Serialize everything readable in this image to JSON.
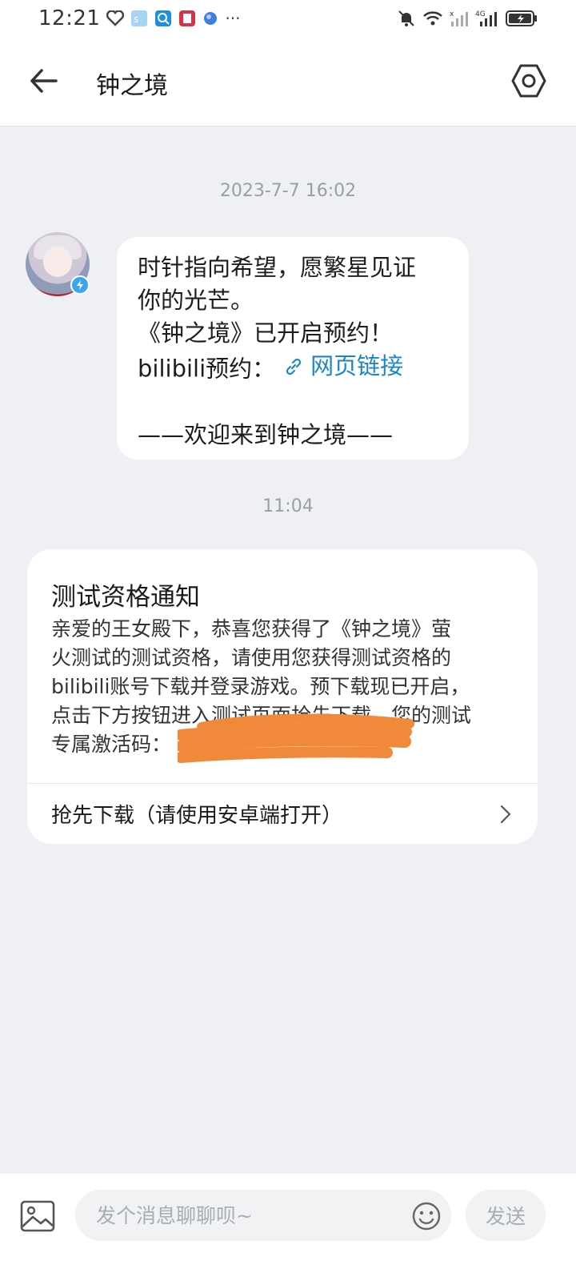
{
  "status_bar": {
    "time": "12:21",
    "icons": [
      "heart-pulse-icon",
      "app-icon",
      "search-app-icon",
      "book-app-icon",
      "globe-app-icon",
      "more-notifications-icon",
      "mute-bell-icon",
      "wifi-icon",
      "signal-icon",
      "4g-signal-icon",
      "battery-charging-icon"
    ],
    "more": "···"
  },
  "header": {
    "title": "钟之境",
    "back_icon": "arrow-left-icon",
    "settings_icon": "hexagon-settings-icon"
  },
  "conversation": {
    "timestamp_1": "2023-7-7 16:02",
    "message_1": {
      "line_1": "时针指向希望，愿繁星见证",
      "line_2": "你的光芒。",
      "line_3": "《钟之境》已开启预约！",
      "line_4_prefix": "bilibili预约：",
      "link_label": "网页链接",
      "line_6": "——欢迎来到钟之境——"
    },
    "timestamp_2": "11:04",
    "card": {
      "title": "测试资格通知",
      "body_lines": [
        "亲爱的王女殿下，恭喜您获得了《钟之境》萤",
        "火测试的测试资格，请使用您获得测试资格的",
        "bilibili账号下载并登录游戏。预下载现已开启，",
        "点击下方按钮进入测试页面抢先下载，您的测试",
        "专属激活码："
      ],
      "action_label": "抢先下载（请使用安卓端打开）"
    }
  },
  "input_bar": {
    "placeholder": "发个消息聊聊呗~",
    "send_label": "发送"
  },
  "colors": {
    "link": "#1c86c7",
    "background": "#eef0f3",
    "redaction": "#f08a3a"
  }
}
